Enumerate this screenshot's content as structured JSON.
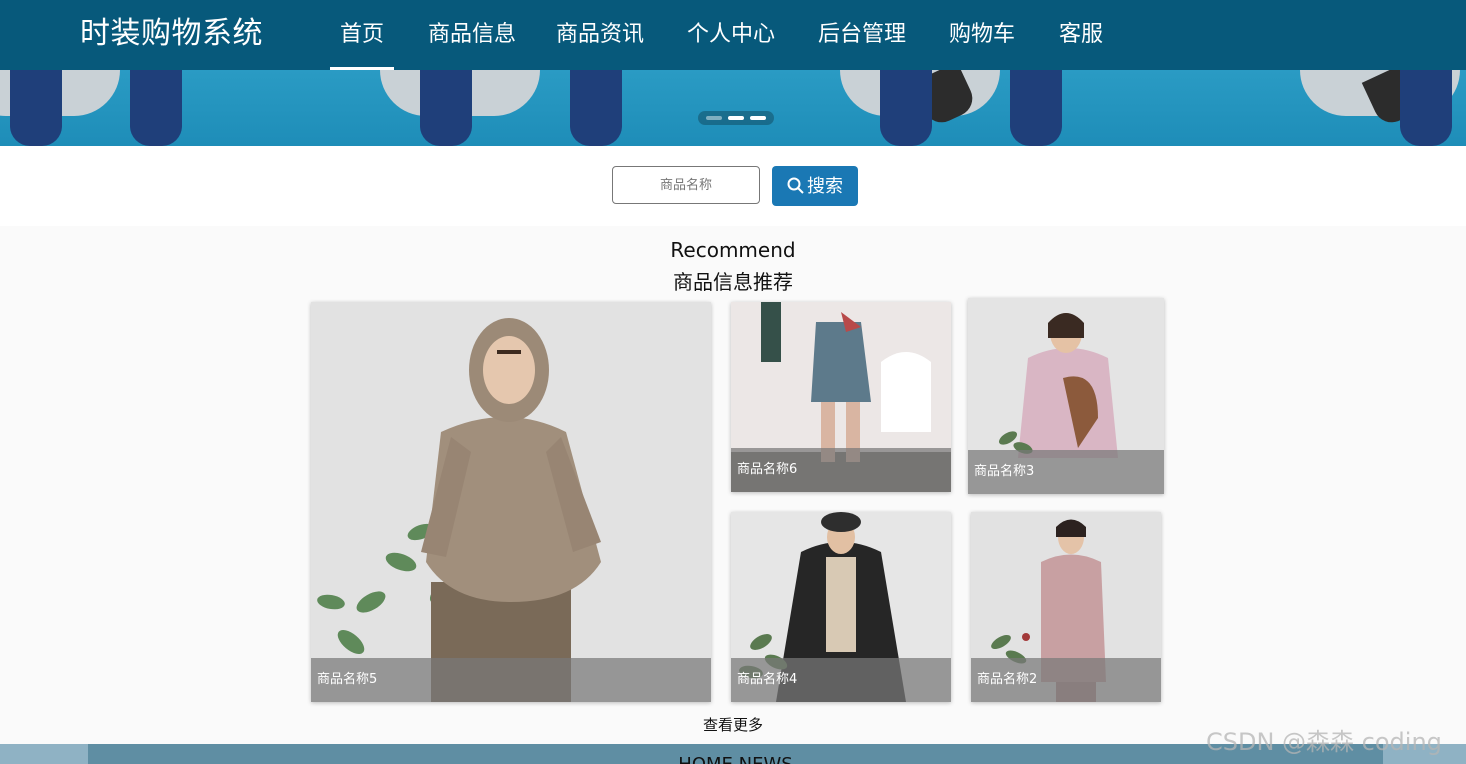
{
  "header": {
    "brand": "时装购物系统",
    "nav": [
      {
        "label": "首页",
        "active": true
      },
      {
        "label": "商品信息",
        "active": false
      },
      {
        "label": "商品资讯",
        "active": false
      },
      {
        "label": "个人中心",
        "active": false
      },
      {
        "label": "后台管理",
        "active": false
      },
      {
        "label": "购物车",
        "active": false
      },
      {
        "label": "客服",
        "active": false
      }
    ]
  },
  "search": {
    "placeholder": "商品名称",
    "button_label": "搜索",
    "button_icon": "search-icon"
  },
  "recommend": {
    "title_en": "Recommend",
    "title_cn": "商品信息推荐",
    "products": [
      {
        "name": "商品名称5"
      },
      {
        "name": "商品名称6"
      },
      {
        "name": "商品名称3"
      },
      {
        "name": "商品名称4"
      },
      {
        "name": "商品名称2"
      }
    ],
    "more_label": "查看更多"
  },
  "news": {
    "title": "HOME NEWS"
  },
  "watermark": "CSDN @森森 coding",
  "colors": {
    "header_bg": "#07597b",
    "accent": "#1a78b4",
    "banner": "#2a9bc4"
  }
}
